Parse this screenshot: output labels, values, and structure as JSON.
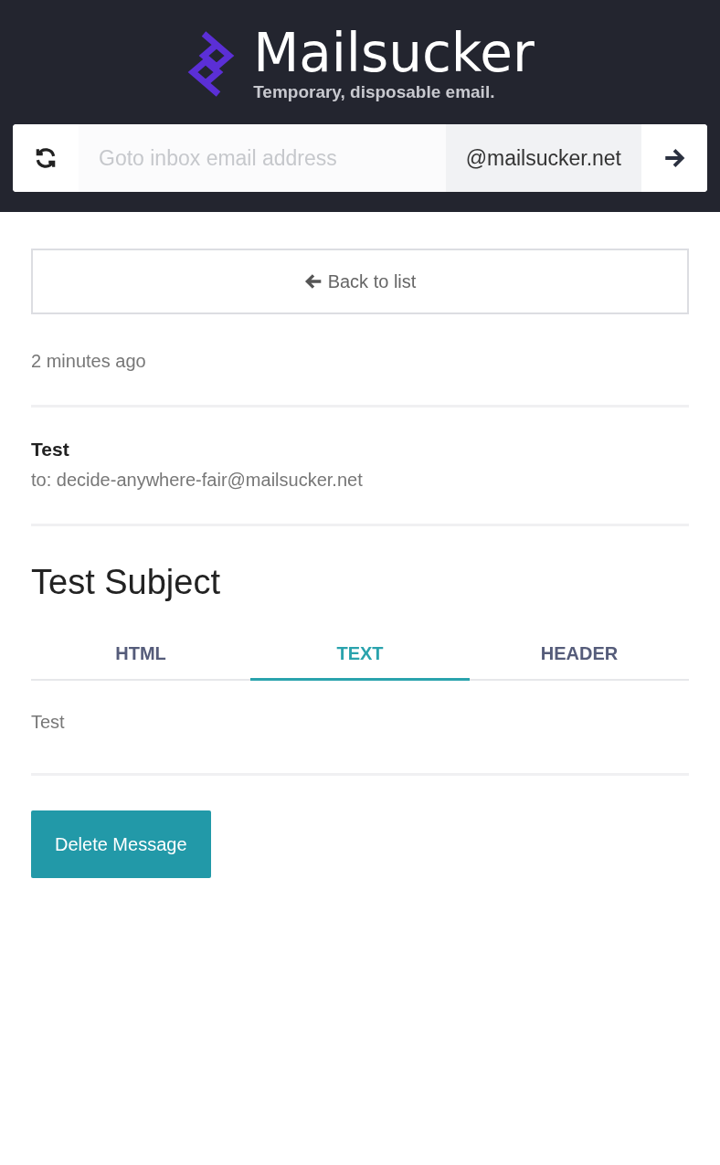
{
  "header": {
    "title": "Mailsucker",
    "tagline": "Temporary, disposable email."
  },
  "inbox_bar": {
    "placeholder": "Goto inbox email address",
    "domain": "@mailsucker.net"
  },
  "back_button": {
    "label": "Back to list"
  },
  "received": "2 minutes ago",
  "sender": {
    "name": "Test",
    "to": "to: decide-anywhere-fair@mailsucker.net"
  },
  "subject": "Test Subject",
  "tabs": [
    {
      "label": "HTML",
      "selected": false
    },
    {
      "label": "TEXT",
      "selected": true
    },
    {
      "label": "HEADER",
      "selected": false
    }
  ],
  "body": "Test",
  "delete_button": {
    "label": "Delete Message"
  }
}
